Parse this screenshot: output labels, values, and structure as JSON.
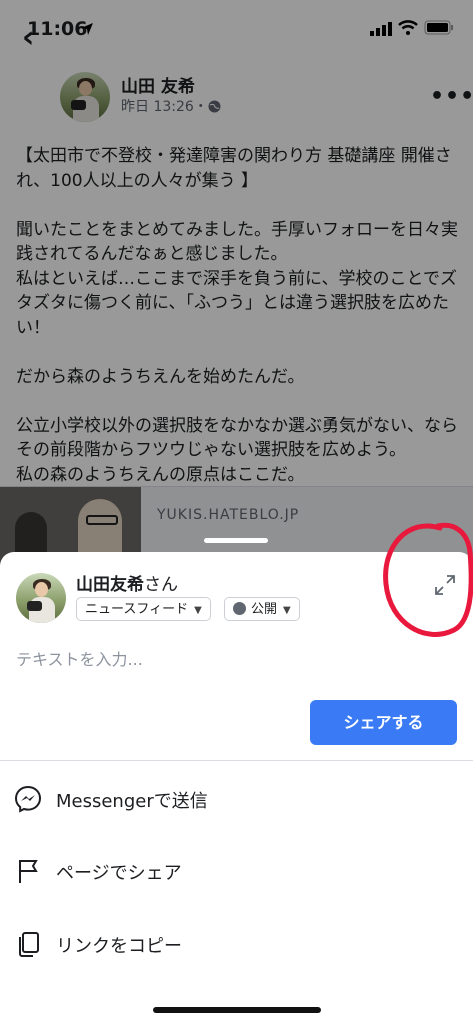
{
  "status_bar": {
    "time": "11:06"
  },
  "post": {
    "author": "山田 友希",
    "timestamp": "昨日 13:26・",
    "text": "【太田市で不登校・発達障害の関わり方 基礎講座 開催され、100人以上の人々が集う 】\n\n聞いたことをまとめてみました。手厚いフォローを日々実践されてるんだなぁと感じました。\n私はといえば…ここまで深手を負う前に、学校のことでズタズタに傷つく前に、「ふつう」とは違う選択肢を広めたい！\n\nだから森のようちえんを始めたんだ。\n\n公立小学校以外の選択肢をなかなか選ぶ勇気がない、ならその前段階からフツウじゃない選択肢を広めよう。\n私の森のようちえんの原点はここだ。",
    "link_domain": "YUKIS.HATEBLO.JP"
  },
  "share_sheet": {
    "user_name": "山田友希",
    "user_suffix": "さん",
    "audience_feed": "ニュースフィード",
    "audience_privacy": "公開",
    "placeholder": "テキストを入力...",
    "share_button": "シェアする",
    "options": [
      {
        "label": "Messengerで送信",
        "icon": "messenger-icon"
      },
      {
        "label": "ページでシェア",
        "icon": "flag-icon"
      },
      {
        "label": "リンクをコピー",
        "icon": "copy-icon"
      }
    ]
  },
  "colors": {
    "accent": "#3a7bf5",
    "annotation": "#e8193c"
  }
}
